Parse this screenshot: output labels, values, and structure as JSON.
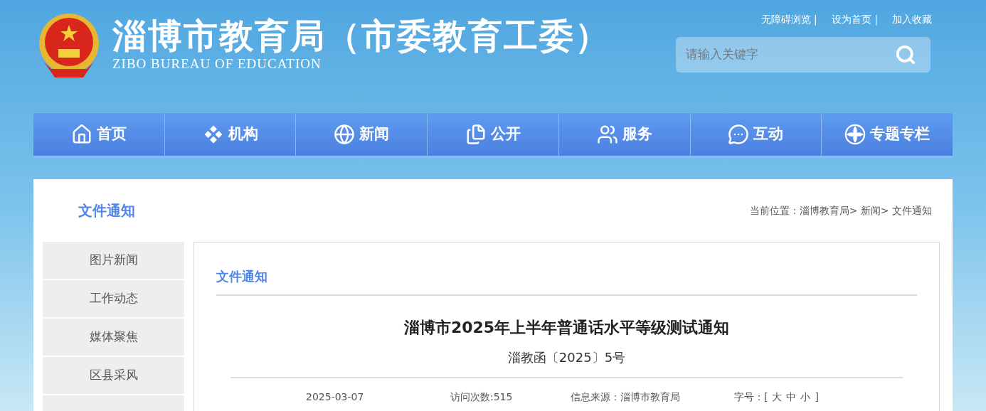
{
  "header": {
    "title": "淄博市教育局（市委教育工委）",
    "subtitle": "ZIBO BUREAU OF EDUCATION",
    "top_links": [
      "无障碍浏览 |",
      "设为首页 |",
      "加入收藏"
    ],
    "search": {
      "placeholder": "请输入关键字"
    }
  },
  "nav": [
    {
      "label": "首页",
      "kind": "home"
    },
    {
      "label": "机构",
      "kind": "org"
    },
    {
      "label": "新闻",
      "kind": "news"
    },
    {
      "label": "公开",
      "kind": "open"
    },
    {
      "label": "服务",
      "kind": "service"
    },
    {
      "label": "互动",
      "kind": "chat"
    },
    {
      "label": "专题专栏",
      "kind": "special"
    }
  ],
  "section_title": "文件通知",
  "breadcrumb": "当前位置：淄博教育局> 新闻> 文件通知",
  "sidebar": {
    "items": [
      "图片新闻",
      "工作动态",
      "媒体聚焦",
      "区县采风"
    ]
  },
  "article": {
    "category": "文件通知",
    "title": "淄博市2025年上半年普通话水平等级测试通知",
    "doc_number": "淄教函〔2025〕5号",
    "date": "2025-03-07",
    "visits": "访问次数:515",
    "source": "信息来源：淄博市教育局",
    "font_size": {
      "label": "字号：",
      "open": "[",
      "options": [
        "大",
        "中",
        "小"
      ],
      "close": "]"
    }
  }
}
